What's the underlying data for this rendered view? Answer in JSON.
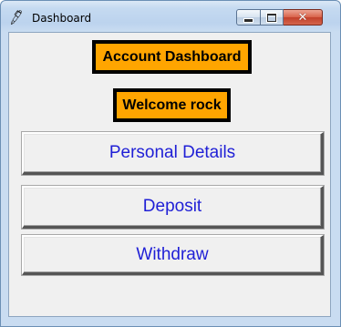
{
  "window": {
    "title": "Dashboard",
    "icon": "feather-icon",
    "controls": {
      "minimize": "minimize-icon",
      "maximize": "maximize-icon",
      "close": "close-icon"
    }
  },
  "labels": {
    "heading": "Account Dashboard",
    "welcome": "Welcome rock"
  },
  "buttons": {
    "personal_details": "Personal Details",
    "deposit": "Deposit",
    "withdraw": "Withdraw"
  },
  "colors": {
    "label_background": "#ffa500",
    "label_border": "#000000",
    "button_text": "#1f1fd6",
    "client_background": "#f0f0f0"
  }
}
